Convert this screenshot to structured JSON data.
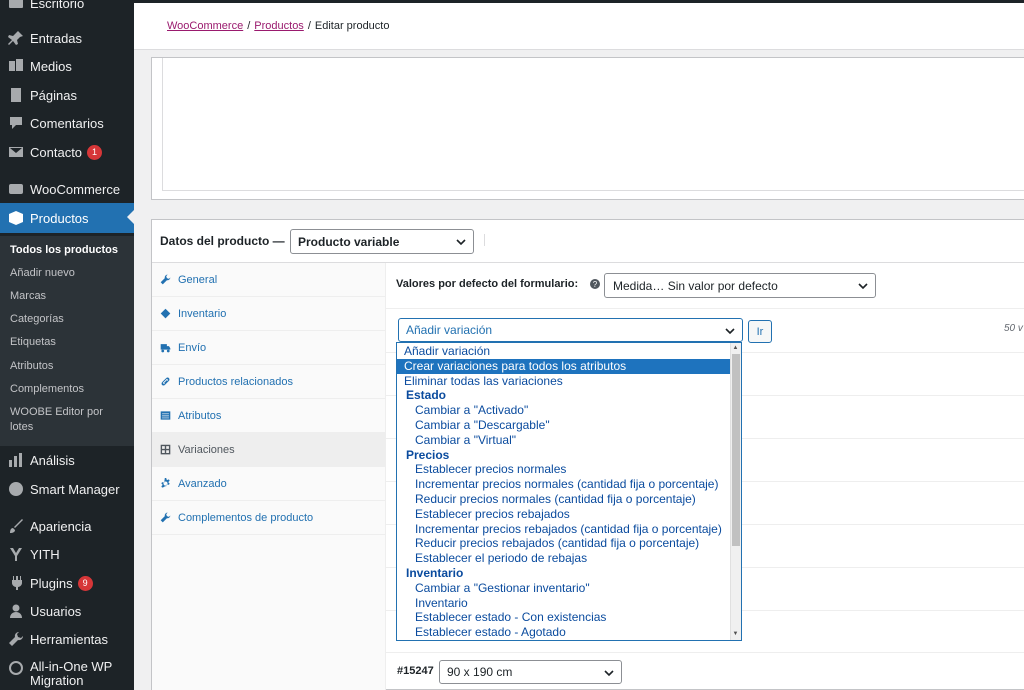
{
  "sidebar": {
    "items": [
      {
        "label": "Escritorio",
        "icon": "dashboard-icon"
      },
      {
        "label": "Entradas",
        "icon": "pin-icon"
      },
      {
        "label": "Medios",
        "icon": "media-icon"
      },
      {
        "label": "Páginas",
        "icon": "page-icon"
      },
      {
        "label": "Comentarios",
        "icon": "comment-icon"
      },
      {
        "label": "Contacto",
        "icon": "mail-icon",
        "badge": "1"
      },
      {
        "label": "WooCommerce",
        "icon": "woo-icon"
      },
      {
        "label": "Productos",
        "icon": "box-icon"
      },
      {
        "label": "Análisis",
        "icon": "bar-chart-icon"
      },
      {
        "label": "Smart Manager",
        "icon": "gauge-icon"
      },
      {
        "label": "Apariencia",
        "icon": "brush-icon"
      },
      {
        "label": "YITH",
        "icon": "yith-icon"
      },
      {
        "label": "Plugins",
        "icon": "plug-icon",
        "badge": "9"
      },
      {
        "label": "Usuarios",
        "icon": "user-icon"
      },
      {
        "label": "Herramientas",
        "icon": "wrench-icon"
      },
      {
        "label": "All-in-One WP Migration",
        "icon": "migration-icon"
      }
    ],
    "submenu": [
      "Todos los productos",
      "Añadir nuevo",
      "Marcas",
      "Categorías",
      "Etiquetas",
      "Atributos",
      "Complementos",
      "WOOBE Editor por lotes"
    ]
  },
  "breadcrumb": {
    "woocommerce": "WooCommerce",
    "productos": "Productos",
    "current": "Editar producto",
    "sep": "/"
  },
  "product_data": {
    "title": "Datos del producto —",
    "type": "Producto variable",
    "tabs": [
      {
        "label": "General",
        "icon": "wrench-icon"
      },
      {
        "label": "Inventario",
        "icon": "tag-icon"
      },
      {
        "label": "Envío",
        "icon": "truck-icon"
      },
      {
        "label": "Productos relacionados",
        "icon": "link-icon"
      },
      {
        "label": "Atributos",
        "icon": "list-icon"
      },
      {
        "label": "Variaciones",
        "icon": "grid-icon"
      },
      {
        "label": "Avanzado",
        "icon": "gear-icon"
      },
      {
        "label": "Complementos de producto",
        "icon": "wrench-icon"
      }
    ],
    "defaults_label": "Valores por defecto del formulario:",
    "defaults_value": "Medida… Sin valor por defecto",
    "action_value": "Añadir variación",
    "go_label": "Ir",
    "count_text": "50 v",
    "variation": {
      "id": "#15247",
      "value": "90 x 190 cm"
    }
  },
  "dropdown": {
    "options": [
      {
        "label": "Añadir variación",
        "kind": "lvl0"
      },
      {
        "label": "Crear variaciones para todos los atributos",
        "kind": "lvl0",
        "highlighted": true
      },
      {
        "label": "Eliminar todas las variaciones",
        "kind": "lvl0"
      },
      {
        "label": "Estado",
        "kind": "grp"
      },
      {
        "label": "Cambiar a \"Activado\"",
        "kind": "lvl1"
      },
      {
        "label": "Cambiar a \"Descargable\"",
        "kind": "lvl1"
      },
      {
        "label": "Cambiar a \"Virtual\"",
        "kind": "lvl1"
      },
      {
        "label": "Precios",
        "kind": "grp"
      },
      {
        "label": "Establecer precios normales",
        "kind": "lvl1"
      },
      {
        "label": "Incrementar precios normales (cantidad fija o porcentaje)",
        "kind": "lvl1"
      },
      {
        "label": "Reducir precios normales (cantidad fija o porcentaje)",
        "kind": "lvl1"
      },
      {
        "label": "Establecer precios rebajados",
        "kind": "lvl1"
      },
      {
        "label": "Incrementar precios rebajados (cantidad fija o porcentaje)",
        "kind": "lvl1"
      },
      {
        "label": "Reducir precios rebajados (cantidad fija o porcentaje)",
        "kind": "lvl1"
      },
      {
        "label": "Establecer el periodo de rebajas",
        "kind": "lvl1"
      },
      {
        "label": "Inventario",
        "kind": "grp"
      },
      {
        "label": "Cambiar a \"Gestionar inventario\"",
        "kind": "lvl1"
      },
      {
        "label": "Inventario",
        "kind": "lvl1"
      },
      {
        "label": "Establecer estado - Con existencias",
        "kind": "lvl1"
      },
      {
        "label": "Establecer estado - Agotado",
        "kind": "lvl1"
      }
    ]
  },
  "colors": {
    "sidebar_bg": "#1d2327",
    "accent": "#2271b1",
    "badge": "#d63638",
    "link_woo": "#9a1a6e"
  }
}
